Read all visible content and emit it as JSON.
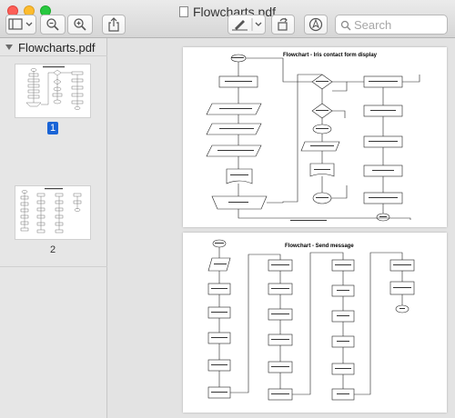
{
  "window": {
    "title": "Flowcharts.pdf"
  },
  "toolbar": {
    "buttons": [
      {
        "name": "sidebar-toggle",
        "icon": "sidebar-icon"
      },
      {
        "name": "zoom-out",
        "icon": "zoom-out-icon"
      },
      {
        "name": "zoom-in",
        "icon": "zoom-in-icon"
      },
      {
        "name": "share",
        "icon": "share-icon"
      },
      {
        "name": "markup",
        "icon": "pen-icon"
      },
      {
        "name": "rotate",
        "icon": "rotate-icon"
      },
      {
        "name": "annotate",
        "icon": "annotate-icon"
      }
    ],
    "search_placeholder": "Search"
  },
  "sidebar": {
    "title": "Flowcharts.pdf",
    "pages": [
      {
        "label": "1",
        "selected": true
      },
      {
        "label": "2",
        "selected": false
      }
    ]
  },
  "document": {
    "pages": [
      {
        "title": "Flowchart - Iris contact form display"
      },
      {
        "title": "Flowchart - Send message"
      }
    ]
  },
  "colors": {
    "selection": "#1a64d6",
    "close": "#fc5f57",
    "minimize": "#fdbc2e",
    "maximize": "#28c840"
  }
}
